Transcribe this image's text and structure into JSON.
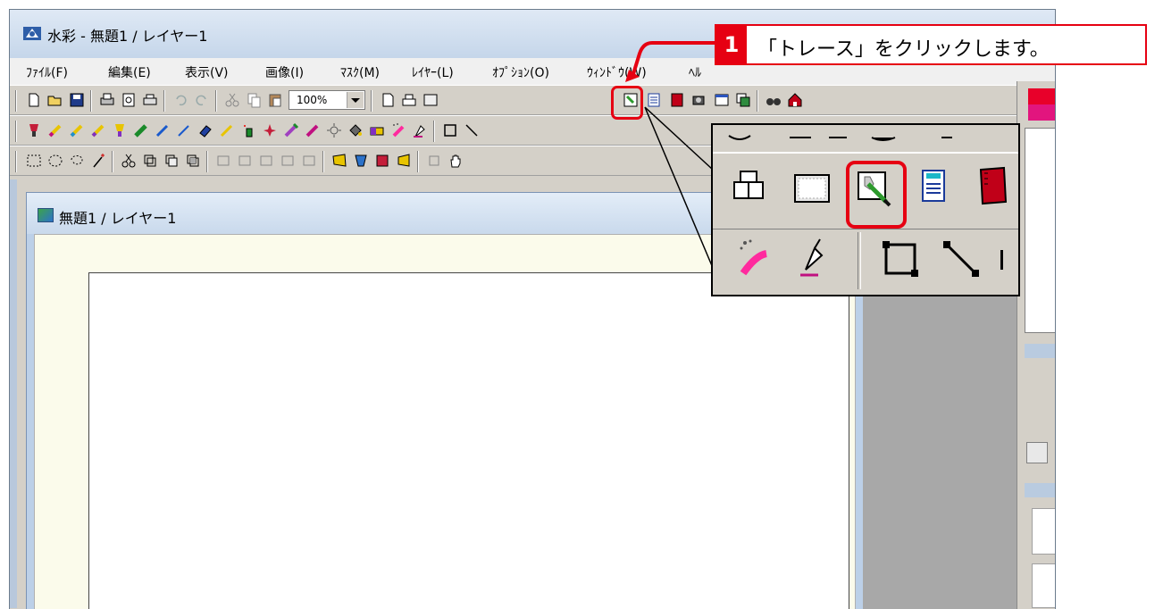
{
  "window": {
    "title": "水彩 - 無題1 / レイヤー1"
  },
  "menu": [
    "ﾌｧｲﾙ(F)",
    "編集(E)",
    "表示(V)",
    "画像(I)",
    "ﾏｽｸ(M)",
    "ﾚｲﾔｰ(L)",
    "ｵﾌﾟｼｮﾝ(O)",
    "ｳｨﾝﾄﾞｳ(W)",
    "ﾍﾙ"
  ],
  "toolbar": {
    "zoom_value": "100%"
  },
  "document": {
    "title": "無題1 / レイヤー1"
  },
  "annotation": {
    "step_number": "1",
    "instruction": "「トレース」をクリックします。"
  },
  "colors": {
    "highlight": "#e60012",
    "foreground_swatch": "#e8002a",
    "background_swatch": "#e2157e"
  }
}
